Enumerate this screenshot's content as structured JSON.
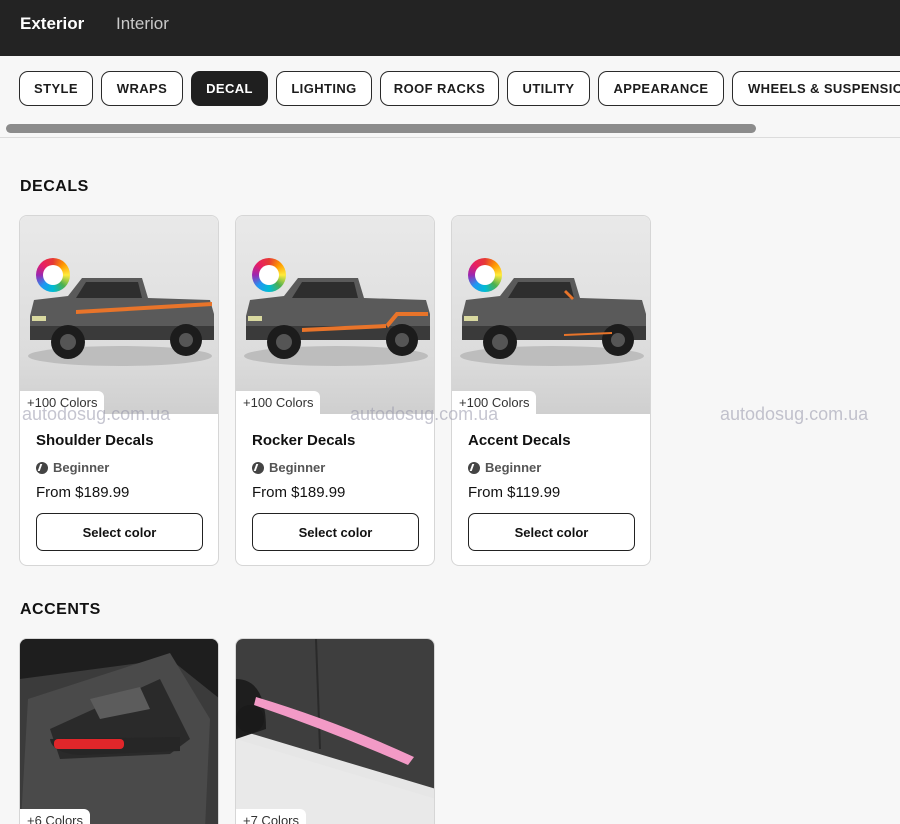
{
  "view_tabs": {
    "active": "Exterior",
    "inactive": "Interior"
  },
  "categories": [
    "STYLE",
    "WRAPS",
    "DECAL",
    "LIGHTING",
    "ROOF RACKS",
    "UTILITY",
    "APPEARANCE",
    "WHEELS & SUSPENSION"
  ],
  "selected_category": "DECAL",
  "decals": {
    "title": "DECALS",
    "items": [
      {
        "name": "Shoulder Decals",
        "colors": "+100 Colors",
        "level": "Beginner",
        "price": "From $189.99",
        "button": "Select color",
        "stripe_color": "#e8742a"
      },
      {
        "name": "Rocker Decals",
        "colors": "+100 Colors",
        "level": "Beginner",
        "price": "From $189.99",
        "button": "Select color",
        "stripe_color": "#e8742a"
      },
      {
        "name": "Accent Decals",
        "colors": "+100 Colors",
        "level": "Beginner",
        "price": "From $119.99",
        "button": "Select color",
        "stripe_color": "#e8742a"
      }
    ]
  },
  "accents": {
    "title": "ACCENTS",
    "items": [
      {
        "colors": "+6 Colors",
        "accent_color": "#e0262a"
      },
      {
        "colors": "+7 Colors",
        "accent_color": "#f29ac6"
      }
    ]
  },
  "watermarks": [
    "autodosug.com.ua",
    "autodosug.com.ua",
    "autodosug.com.ua"
  ]
}
